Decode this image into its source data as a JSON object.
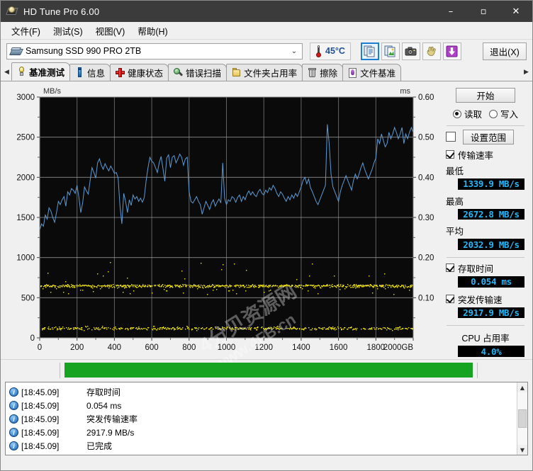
{
  "window": {
    "title": "HD Tune Pro 6.00",
    "minimize": "–",
    "maximize": "▫",
    "close": "✕"
  },
  "menu": [
    "文件(F)",
    "测试(S)",
    "视图(V)",
    "帮助(H)"
  ],
  "device": {
    "name": "Samsung SSD 990 PRO 2TB",
    "caret": "⌄",
    "temperature": "45°C",
    "exit_label": "退出(X)"
  },
  "toolbar_icons": [
    "copy-document-icon",
    "copy-image-icon",
    "camera-icon",
    "hand-icon",
    "download-icon"
  ],
  "tabs": {
    "prev_arrow": "◀",
    "next_arrow": "▶",
    "items": [
      {
        "label": "基准测试",
        "icon": "bulb-icon",
        "active": true
      },
      {
        "label": "信息",
        "icon": "info-icon",
        "active": false
      },
      {
        "label": "健康状态",
        "icon": "cross-icon",
        "active": false
      },
      {
        "label": "错误扫描",
        "icon": "magnifier-icon",
        "active": false
      },
      {
        "label": "文件夹占用率",
        "icon": "folder-icon",
        "active": false
      },
      {
        "label": "擦除",
        "icon": "trash-icon",
        "active": false
      },
      {
        "label": "文件基准",
        "icon": "document-icon",
        "active": false
      }
    ]
  },
  "panel": {
    "start_label": "开始",
    "mode_read": "读取",
    "mode_write": "写入",
    "mode_selected": "读取",
    "range_checkbox_checked": false,
    "range_label": "设置范围",
    "transfer_rate": {
      "label": "传输速率",
      "checked": true,
      "min_label": "最低",
      "min_value": "1339.9 MB/s",
      "max_label": "最高",
      "max_value": "2672.8 MB/s",
      "avg_label": "平均",
      "avg_value": "2032.9 MB/s"
    },
    "access_time": {
      "label": "存取时间",
      "checked": true,
      "value": "0.054 ms"
    },
    "burst_rate": {
      "label": "突发传输速",
      "checked": true,
      "value": "2917.9 MB/s"
    },
    "cpu": {
      "label": "CPU 占用率",
      "value": "4.0%"
    },
    "value_color": "#29b6f6"
  },
  "progress": {
    "percent": 100,
    "fill_color": "#15a321"
  },
  "log": {
    "rows": [
      {
        "time": "[18:45.09]",
        "message": "存取时间"
      },
      {
        "time": "[18:45.09]",
        "message": "0.054 ms"
      },
      {
        "time": "[18:45.09]",
        "message": "突发传输速率"
      },
      {
        "time": "[18:45.09]",
        "message": "2917.9 MB/s"
      },
      {
        "time": "[18:45.09]",
        "message": "已完成"
      }
    ],
    "scroll_up": "▲",
    "scroll_down": "▼"
  },
  "watermark": {
    "line1": "4分贝资源网",
    "line2": "www.4FB.cn"
  },
  "chart_data": {
    "type": "line",
    "title": "",
    "ylabel": "MB/s",
    "y2label": "ms",
    "xlabel": "2000GB",
    "xlim": [
      0,
      2000
    ],
    "ylim": [
      0,
      3000
    ],
    "y2lim": [
      0,
      0.6
    ],
    "xticks": [
      0,
      200,
      400,
      600,
      800,
      1000,
      1200,
      1400,
      1600,
      1800,
      2000
    ],
    "xticklabels": [
      "0",
      "200",
      "400",
      "600",
      "800",
      "1000",
      "1200",
      "1400",
      "1600",
      "1800",
      "2000GB"
    ],
    "yticks": [
      0,
      500,
      1000,
      1500,
      2000,
      2500,
      3000
    ],
    "y2ticks": [
      0.1,
      0.2,
      0.3,
      0.4,
      0.5,
      0.6
    ],
    "grid": true,
    "plot_bg": "#0a0a0a",
    "grid_color": "#9a9a9a",
    "series": [
      {
        "name": "传输速率",
        "color": "#5b9bd5",
        "unit": "MB/s",
        "axis": "left",
        "x": [
          0,
          10,
          20,
          30,
          40,
          50,
          60,
          70,
          80,
          90,
          100,
          110,
          120,
          130,
          140,
          150,
          160,
          170,
          180,
          190,
          200,
          210,
          220,
          230,
          240,
          250,
          260,
          270,
          280,
          290,
          300,
          310,
          320,
          330,
          340,
          350,
          360,
          370,
          380,
          390,
          400,
          410,
          420,
          430,
          440,
          450,
          460,
          470,
          480,
          490,
          500,
          510,
          520,
          530,
          540,
          550,
          560,
          570,
          580,
          590,
          600,
          610,
          620,
          630,
          640,
          650,
          660,
          670,
          680,
          690,
          700,
          710,
          720,
          730,
          740,
          750,
          760,
          770,
          780,
          790,
          800,
          810,
          820,
          830,
          840,
          850,
          860,
          870,
          880,
          890,
          900,
          910,
          920,
          930,
          940,
          950,
          960,
          970,
          980,
          990,
          1000,
          1010,
          1020,
          1030,
          1040,
          1050,
          1060,
          1070,
          1080,
          1090,
          1100,
          1110,
          1120,
          1130,
          1140,
          1150,
          1160,
          1170,
          1180,
          1190,
          1200,
          1210,
          1220,
          1230,
          1240,
          1250,
          1260,
          1270,
          1280,
          1290,
          1300,
          1310,
          1320,
          1330,
          1340,
          1350,
          1360,
          1370,
          1380,
          1390,
          1400,
          1410,
          1420,
          1430,
          1440,
          1450,
          1460,
          1470,
          1480,
          1490,
          1500,
          1510,
          1520,
          1530,
          1540,
          1550,
          1560,
          1570,
          1580,
          1590,
          1600,
          1610,
          1620,
          1630,
          1640,
          1650,
          1660,
          1670,
          1680,
          1690,
          1700,
          1710,
          1720,
          1730,
          1740,
          1750,
          1760,
          1770,
          1780,
          1790,
          1800,
          1810,
          1820,
          1830,
          1840,
          1850,
          1860,
          1870,
          1880,
          1890,
          1900,
          1910,
          1920,
          1930,
          1940,
          1950,
          1960,
          1970,
          1980,
          1990,
          2000
        ],
        "values": [
          1345,
          1420,
          1390,
          1530,
          1480,
          1620,
          1580,
          1500,
          1440,
          1560,
          1700,
          1660,
          1720,
          1760,
          1640,
          1820,
          1780,
          1860,
          1840,
          1800,
          1900,
          1750,
          1560,
          1680,
          1880,
          1830,
          1790,
          1960,
          2120,
          2060,
          1990,
          2180,
          2230,
          2150,
          2100,
          2170,
          2120,
          2080,
          2140,
          2100,
          2050,
          2060,
          1990,
          1640,
          1420,
          1800,
          1700,
          1560,
          1720,
          1650,
          1780,
          1730,
          1760,
          1700,
          1740,
          1690,
          1750,
          1960,
          2120,
          2250,
          2200,
          2180,
          2120,
          2060,
          2180,
          2260,
          2110,
          1950,
          2240,
          2280,
          2120,
          2250,
          2270,
          2180,
          2230,
          2290,
          2250,
          2150,
          2230,
          2250,
          1820,
          1700,
          1680,
          1720,
          1760,
          1700,
          1660,
          1540,
          1620,
          1700,
          1650,
          1600,
          1680,
          1720,
          1640,
          1690,
          1730,
          1680,
          2180,
          1740,
          1660,
          1720,
          1700,
          1760,
          1740,
          1690,
          1750,
          1780,
          1700,
          1760,
          1720,
          1790,
          1830,
          1780,
          1820,
          1780,
          1760,
          1820,
          1850,
          1800,
          1780,
          1840,
          1810,
          1870,
          1840,
          1900,
          1860,
          1800,
          1760,
          1820,
          1790,
          1740,
          1700,
          1760,
          1720,
          1780,
          1740,
          1800,
          1760,
          1820,
          1880,
          1960,
          2000,
          1920,
          1980,
          1870,
          1820,
          1760,
          1700,
          1660,
          1720,
          1780,
          1840,
          1900,
          2660,
          2420,
          2040,
          1880,
          1820,
          1760,
          1700,
          1820,
          1900,
          1960,
          2020,
          1960,
          1900,
          1840,
          1960,
          2040,
          1980,
          2040,
          2120,
          2180,
          2100,
          2040,
          1980,
          2040,
          2100,
          2180,
          2240,
          2480,
          2420,
          2540,
          2460,
          2380,
          2420,
          2560,
          2480,
          2540,
          2620,
          2560,
          2480,
          2540,
          2620,
          2420,
          2540,
          2480,
          2560,
          2620,
          2560,
          2500,
          2460,
          2520,
          2580,
          2540,
          2480,
          2540,
          2560,
          2520,
          2580,
          2540,
          2500,
          2560,
          2620,
          2580
        ]
      },
      {
        "name": "存取时间",
        "color": "#f2e500",
        "unit": "ms",
        "axis": "right",
        "style": "scatter",
        "typical_value": 0.054,
        "band_low": 0.02,
        "band_high": 0.13,
        "outlier_high": 0.135
      }
    ]
  }
}
